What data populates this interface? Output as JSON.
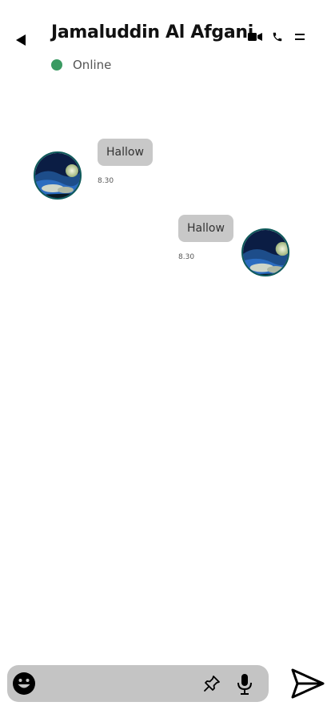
{
  "header": {
    "title": "Jamaluddin Al Afgani",
    "status_text": "Online",
    "status_color": "#3a9a62",
    "back_icon": "back-arrow-icon",
    "actions": [
      "video-camera-icon",
      "phone-icon",
      "menu-icon"
    ]
  },
  "messages": [
    {
      "direction": "incoming",
      "text": "Hallow",
      "time": "8.30"
    },
    {
      "direction": "outgoing",
      "text": "Hallow",
      "time": "8.30"
    }
  ],
  "composer": {
    "placeholder": "",
    "value": "",
    "icons": [
      "emoji-icon",
      "pin-icon",
      "microphone-icon",
      "send-icon"
    ]
  },
  "colors": {
    "bubble": "#c8c8c8",
    "input_bar": "#c4c4c4",
    "avatar_border": "#0e5a5a"
  }
}
